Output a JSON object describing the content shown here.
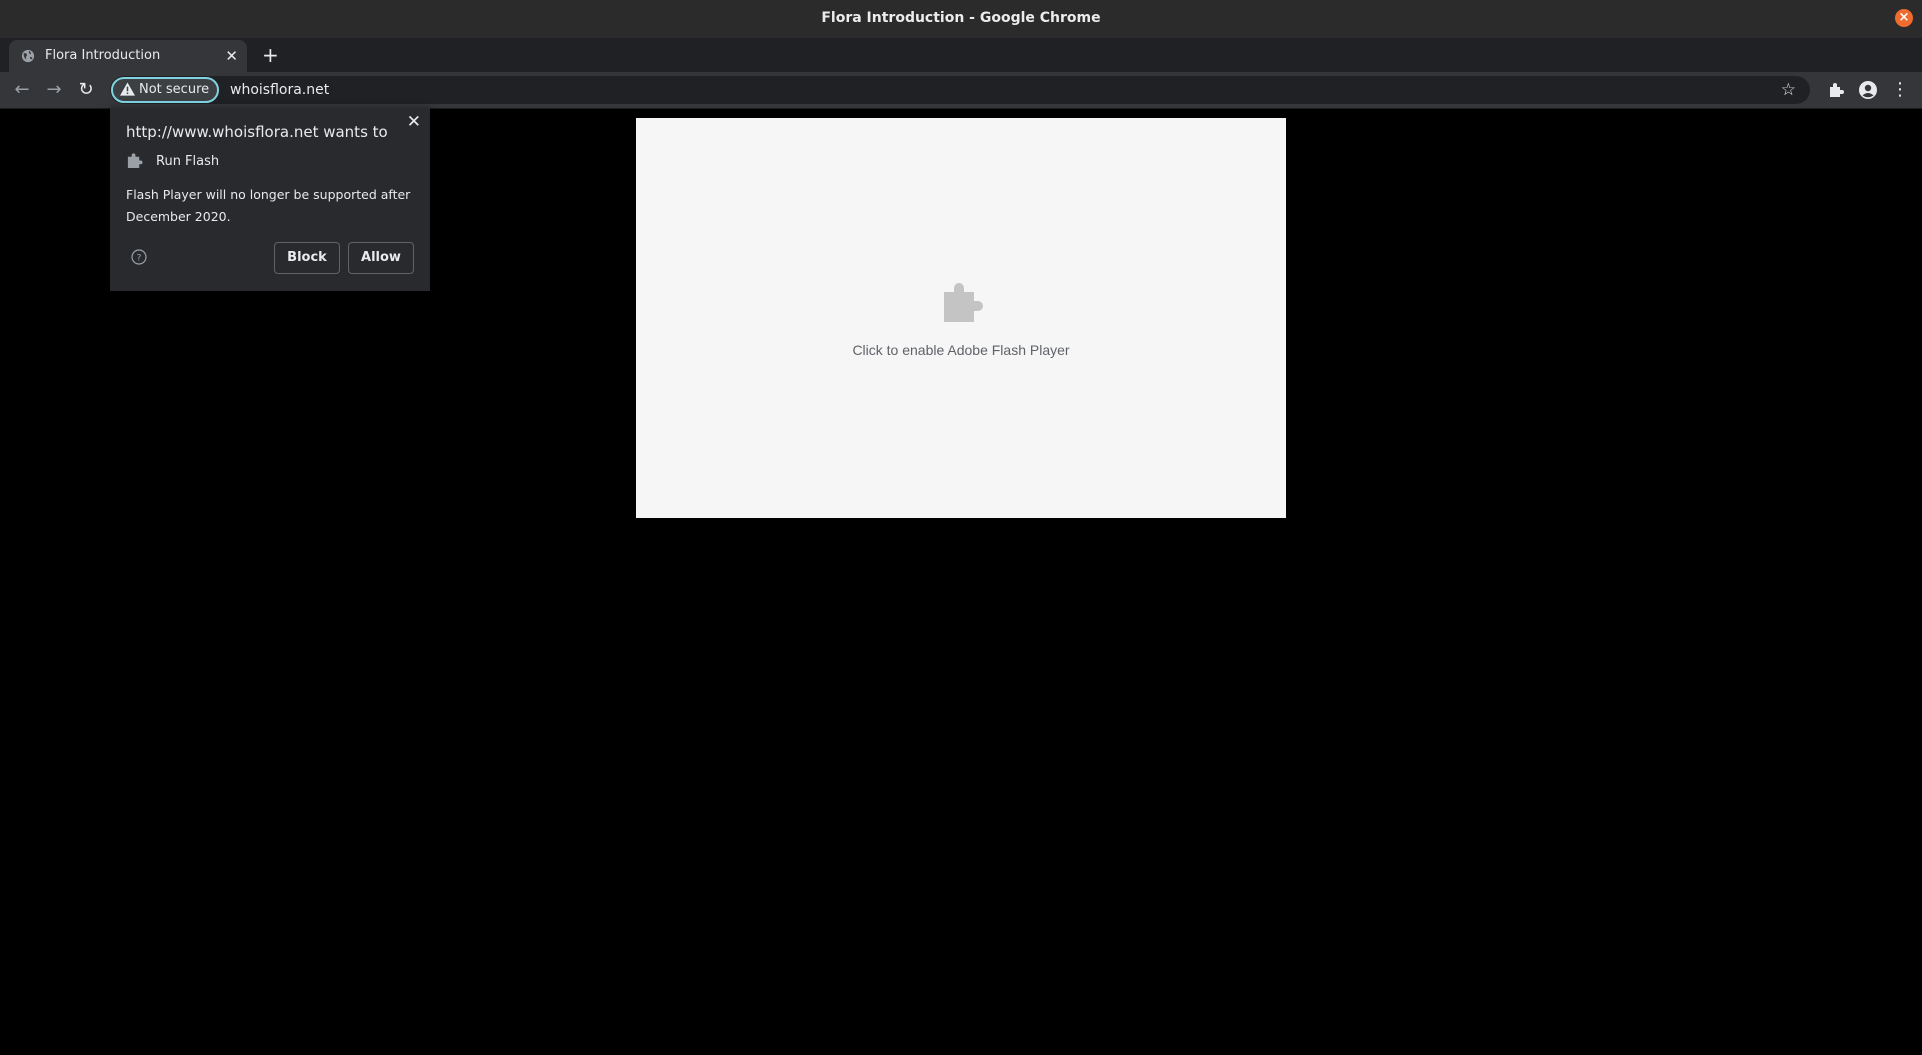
{
  "window": {
    "title": "Flora Introduction - Google Chrome"
  },
  "tabs": [
    {
      "label": "Flora Introduction"
    }
  ],
  "toolbar": {
    "security_chip": "Not secure",
    "url": "whoisflora.net"
  },
  "permission_bubble": {
    "origin_text": "http://www.whoisflora.net wants to",
    "permission": "Run Flash",
    "description": "Flash Player will no longer be supported after December 2020.",
    "block_label": "Block",
    "allow_label": "Allow"
  },
  "plugin_placeholder": {
    "text": "Click to enable Adobe Flash Player"
  },
  "colors": {
    "accent_close": "#f06b2f",
    "chip_outline": "#7fd3e0",
    "page_background": "#000000",
    "plugin_background": "#f6f6f6"
  }
}
